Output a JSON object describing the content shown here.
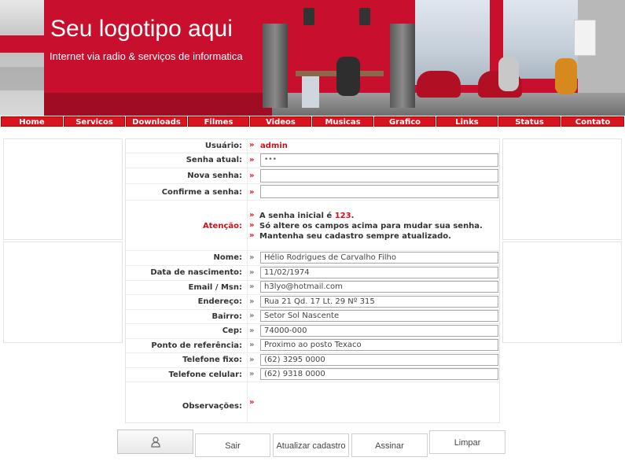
{
  "header": {
    "logo_title": "Seu logotipo aqui",
    "logo_subtitle": "Internet via radio & serviços de informatica"
  },
  "nav": [
    "Home",
    "Servicos",
    "Downloads",
    "Filmes",
    "Videos",
    "Musicas",
    "Grafico",
    "Links",
    "Status",
    "Contato"
  ],
  "form": {
    "usuario": {
      "label": "Usuário:",
      "value": "admin"
    },
    "senha_atual": {
      "label": "Senha atual:",
      "value": "•••"
    },
    "nova_senha": {
      "label": "Nova senha:",
      "value": ""
    },
    "confirme": {
      "label": "Confirme a senha:",
      "value": ""
    },
    "atencao": {
      "label": "Atenção:",
      "line1_prefix": "A senha inicial é ",
      "line1_highlight": "123",
      "line1_suffix": ".",
      "line2": "Só altere os campos acima para mudar sua senha.",
      "line3": "Mantenha seu cadastro sempre atualizado."
    },
    "nome": {
      "label": "Nome:",
      "value": "Hélio Rodrigues de Carvalho Filho"
    },
    "nascimento": {
      "label": "Data de nascimento:",
      "value": "11/02/1974"
    },
    "email": {
      "label": "Email / Msn:",
      "value": "h3lyo@hotmail.com"
    },
    "endereco": {
      "label": "Endereço:",
      "value": "Rua 21 Qd. 17 Lt. 29 Nº 315"
    },
    "bairro": {
      "label": "Bairro:",
      "value": "Setor Sol Nascente"
    },
    "cep": {
      "label": "Cep:",
      "value": "74000-000"
    },
    "referencia": {
      "label": "Ponto de referência:",
      "value": "Proximo ao posto Texaco"
    },
    "fixo": {
      "label": "Telefone fixo:",
      "value": "(62) 3295 0000"
    },
    "celular": {
      "label": "Telefone celular:",
      "value": "(62) 9318 0000"
    },
    "observacoes": {
      "label": "Observações:",
      "value": ""
    }
  },
  "buttons": {
    "sair": "Sair",
    "atualizar": "Atualizar cadastro",
    "assinar": "Assinar",
    "limpar": "Limpar"
  },
  "icons": {
    "arrow": "double-chevron-right-icon",
    "user": "user-icon"
  },
  "colors": {
    "brand_red": "#c8102e",
    "nav_red": "#d7151f",
    "accent_red": "#d0101c"
  }
}
